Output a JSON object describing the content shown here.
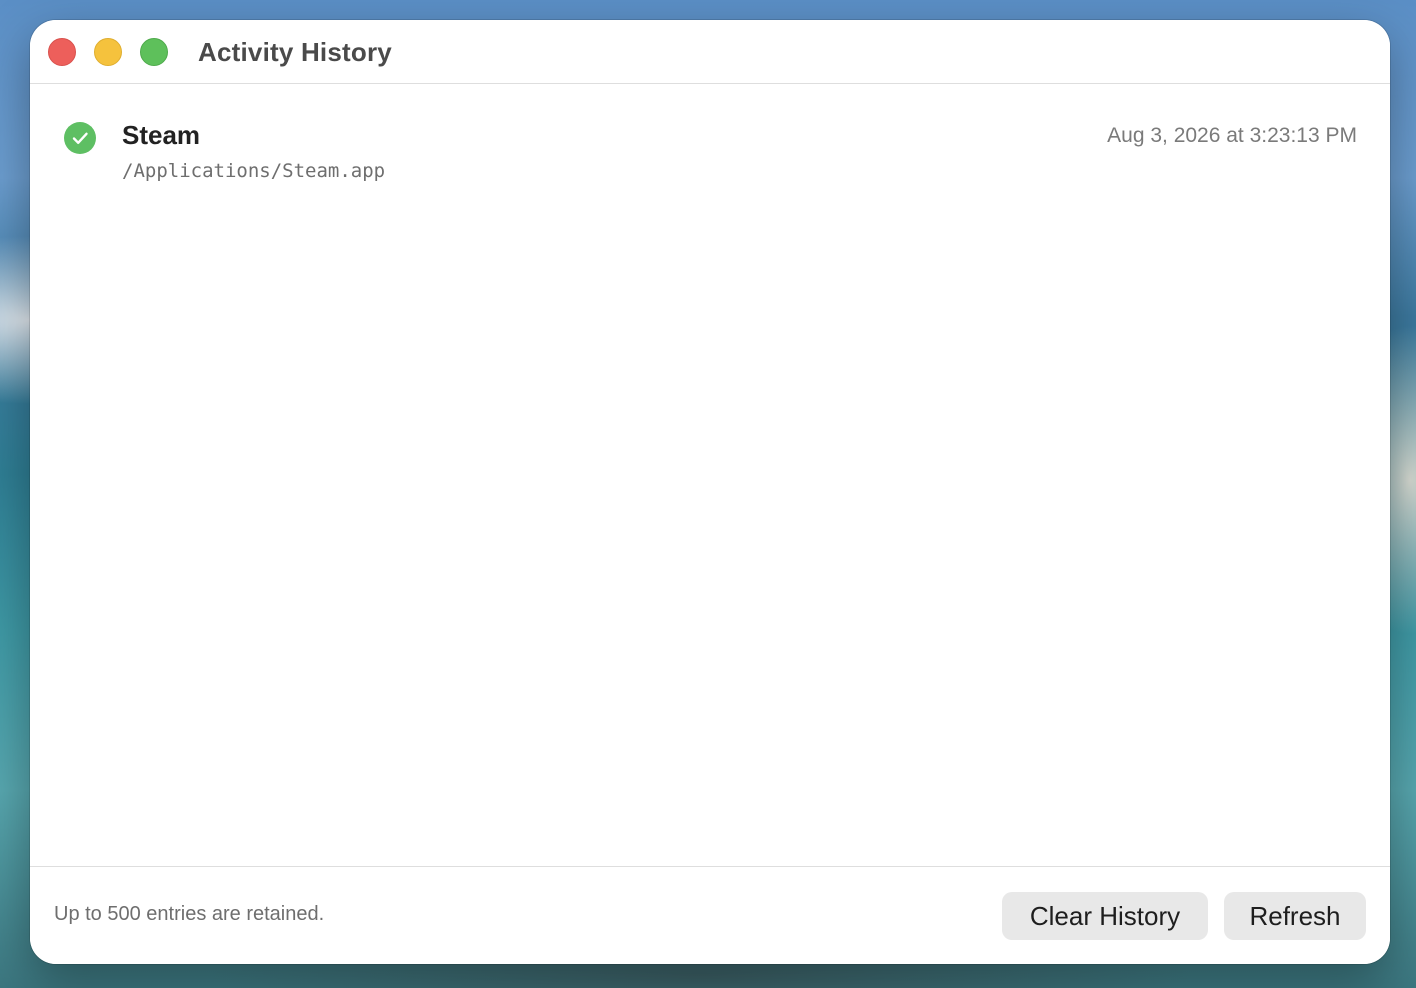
{
  "window": {
    "title": "Activity History",
    "controls": {
      "close_color": "#ed5f5b",
      "minimize_color": "#f5c23d",
      "zoom_color": "#5ec05b"
    }
  },
  "history": {
    "entries": [
      {
        "name": "Steam",
        "path": "/Applications/Steam.app",
        "timestamp": "Aug 3, 2026 at 3:23:13 PM",
        "status_icon": "checkmark-circle-icon",
        "status_color": "#5ebf63"
      }
    ]
  },
  "footer": {
    "note": "Up to 500 entries are retained.",
    "clear_label": "Clear History",
    "refresh_label": "Refresh"
  }
}
